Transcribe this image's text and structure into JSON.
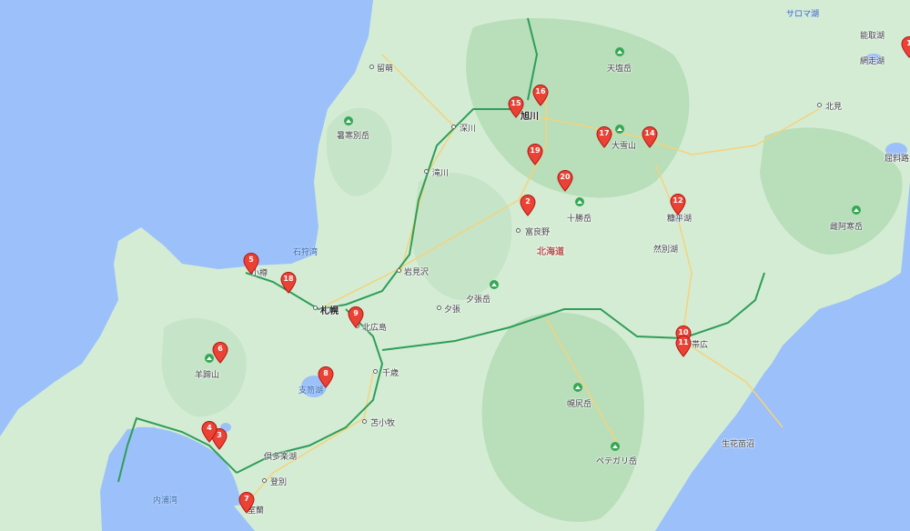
{
  "map": {
    "labels": {
      "sarobetsu": "サロマ湖",
      "rumoi": "留萌",
      "tenshio": "天塩岳",
      "asahikawa": "旭川",
      "fukagawa": "深川",
      "takikawa": "滝川",
      "shokanbetsu": "暑寒別岳",
      "taisetsu": "大雪山",
      "tokachi": "十勝岳",
      "furano": "富良野",
      "hokkaido": "北海道",
      "shikaribetsu": "糠平湖",
      "nukabira": "然別湖",
      "ishikari_bay": "石狩湾",
      "otaru": "小樽",
      "sapporo": "札幌",
      "iwamizawa": "岩見沢",
      "yubari": "夕張",
      "yubaridake": "夕張岳",
      "kitahiroshima": "北広島",
      "chitose": "千歳",
      "shikotsu": "支笏湖",
      "yoteizan": "羊蹄山",
      "tomakomai": "苫小牧",
      "kuttara": "倶多楽湖",
      "noboribetsu": "登別",
      "muroran": "室蘭",
      "uchiura": "内浦湾",
      "obihiro": "帯広",
      "poroshiri": "幌尻岳",
      "pekereta": "ペテガリ岳",
      "seikosho": "生花苗沼",
      "kitami": "北見",
      "abashiri": "網走湖",
      "notoro": "能取湖",
      "akan": "雌阿寒岳",
      "kussharo": "屈斜路湖"
    },
    "pins": [
      "1",
      "2",
      "3",
      "4",
      "5",
      "6",
      "7",
      "8",
      "9",
      "10",
      "11",
      "12",
      "14",
      "15",
      "16",
      "17",
      "18",
      "19",
      "20"
    ],
    "colors": {
      "water": "#9cc0f9",
      "land": "#d4ecd4",
      "forest": "#b8deba",
      "highway": "#2e9e58",
      "road": "#f6d27a",
      "pin": "#ea4335"
    }
  }
}
